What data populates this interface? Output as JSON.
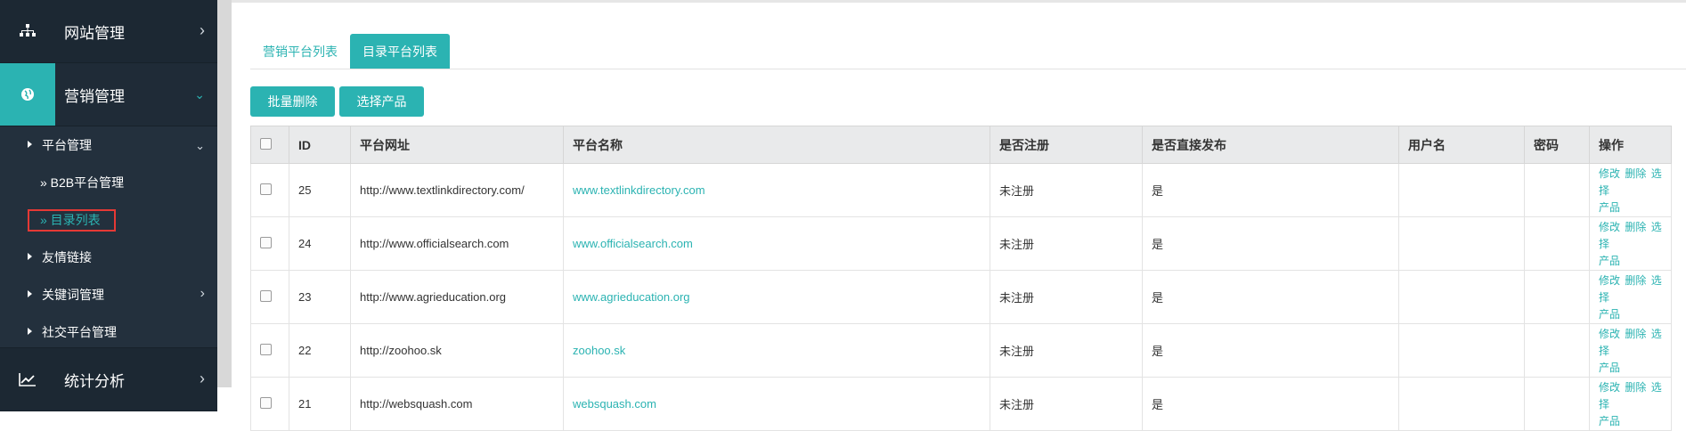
{
  "sidebar": {
    "top_items": [
      {
        "label": "网站管理",
        "icon": "sitemap-icon"
      },
      {
        "label": "营销管理",
        "icon": "globe-icon"
      },
      {
        "label": "统计分析",
        "icon": "chart-line-icon"
      }
    ],
    "sub_items": {
      "platform_mgmt": "平台管理",
      "b2b": "» B2B平台管理",
      "directory": "» 目录列表",
      "friend_links": "友情链接",
      "keyword_mgmt": "关键词管理",
      "social_mgmt": "社交平台管理"
    }
  },
  "tabs": [
    {
      "label": "营销平台列表"
    },
    {
      "label": "目录平台列表"
    }
  ],
  "buttons": {
    "batch_delete": "批量删除",
    "select_product": "选择产品"
  },
  "table": {
    "headers": [
      "ID",
      "平台网址",
      "平台名称",
      "是否注册",
      "是否直接发布",
      "用户名",
      "密码",
      "操作"
    ],
    "rows": [
      {
        "id": "25",
        "url": "http://www.textlinkdirectory.com/",
        "name": "www.textlinkdirectory.com",
        "registered": "未注册",
        "direct": "是",
        "user": "",
        "pwd": ""
      },
      {
        "id": "24",
        "url": "http://www.officialsearch.com",
        "name": "www.officialsearch.com",
        "registered": "未注册",
        "direct": "是",
        "user": "",
        "pwd": ""
      },
      {
        "id": "23",
        "url": "http://www.agrieducation.org",
        "name": "www.agrieducation.org",
        "registered": "未注册",
        "direct": "是",
        "user": "",
        "pwd": ""
      },
      {
        "id": "22",
        "url": "http://zoohoo.sk",
        "name": "zoohoo.sk",
        "registered": "未注册",
        "direct": "是",
        "user": "",
        "pwd": ""
      },
      {
        "id": "21",
        "url": "http://websquash.com",
        "name": "websquash.com",
        "registered": "未注册",
        "direct": "是",
        "user": "",
        "pwd": ""
      }
    ],
    "ops": {
      "edit": "修改",
      "delete": "删除",
      "select": "选择",
      "product": "产品"
    }
  },
  "colors": {
    "accent": "#2bb3b2",
    "sidebar": "#23303d",
    "highlight_box": "#e53935"
  }
}
